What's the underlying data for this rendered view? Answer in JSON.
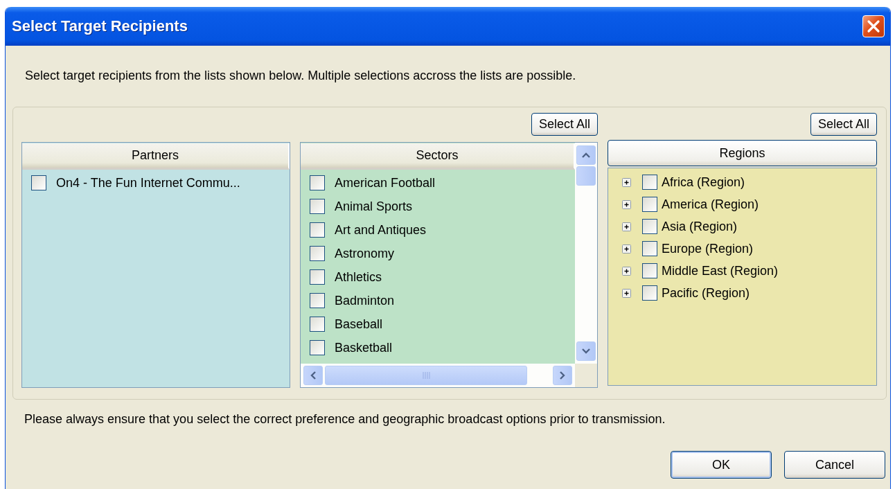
{
  "window": {
    "title": "Select Target Recipients"
  },
  "intro": "Select target recipients from the lists shown below. Multiple selections accross the lists are possible.",
  "partners": {
    "header": "Partners",
    "items": [
      {
        "label": "On4 - The Fun Internet Commu...",
        "checked": false
      }
    ]
  },
  "sectors": {
    "select_all": "Select All",
    "header": "Sectors",
    "items": [
      {
        "label": "American Football",
        "checked": false
      },
      {
        "label": "Animal Sports",
        "checked": false
      },
      {
        "label": "Art and Antiques",
        "checked": false
      },
      {
        "label": "Astronomy",
        "checked": false
      },
      {
        "label": "Athletics",
        "checked": false
      },
      {
        "label": "Badminton",
        "checked": false
      },
      {
        "label": "Baseball",
        "checked": false
      },
      {
        "label": "Basketball",
        "checked": false
      }
    ]
  },
  "regions": {
    "select_all": "Select All",
    "header": "Regions",
    "items": [
      {
        "label": "Africa (Region)",
        "checked": false,
        "expanded": false
      },
      {
        "label": "America (Region)",
        "checked": false,
        "expanded": false
      },
      {
        "label": "Asia (Region)",
        "checked": false,
        "expanded": false
      },
      {
        "label": "Europe (Region)",
        "checked": false,
        "expanded": false
      },
      {
        "label": "Middle East (Region)",
        "checked": false,
        "expanded": false
      },
      {
        "label": "Pacific (Region)",
        "checked": false,
        "expanded": false
      }
    ]
  },
  "footer_note": "Please always ensure that you select the correct preference and geographic broadcast options prior to transmission.",
  "buttons": [
    {
      "label": "OK",
      "default": true
    },
    {
      "label": "Cancel",
      "default": false
    }
  ]
}
